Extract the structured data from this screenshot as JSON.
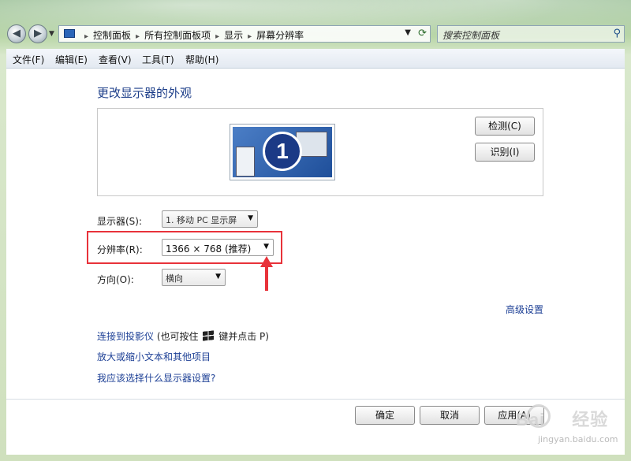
{
  "address_bar": {
    "crumbs": [
      "控制面板",
      "所有控制面板项",
      "显示",
      "屏幕分辨率"
    ],
    "search_placeholder": "搜索控制面板"
  },
  "menu": [
    "文件(F)",
    "编辑(E)",
    "查看(V)",
    "工具(T)",
    "帮助(H)"
  ],
  "main": {
    "heading": "更改显示器的外观",
    "monitor_number": "1",
    "detect_button": "检测(C)",
    "identify_button": "识别(I)",
    "display_label": "显示器(S):",
    "display_value": "1. 移动 PC 显示屏",
    "resolution_label": "分辨率(R):",
    "resolution_value": "1366 × 768 (推荐)",
    "orientation_label": "方向(O):",
    "orientation_value": "横向",
    "advanced_link": "高级设置",
    "links": {
      "projector": "连接到投影仪",
      "projector_hint_prefix": "(也可按住",
      "projector_hint_suffix": "键并点击 P)",
      "text_size": "放大或缩小文本和其他项目",
      "which_settings": "我应该选择什么显示器设置?"
    },
    "ok_button": "确定",
    "cancel_button": "取消",
    "apply_button": "应用(A)"
  },
  "watermark": {
    "brand": "Bai",
    "brand2": "经验",
    "url": "jingyan.baidu.com"
  },
  "colors": {
    "highlight_box": "#e8323a",
    "link": "#1c3f95",
    "heading": "#1e3f8a"
  }
}
